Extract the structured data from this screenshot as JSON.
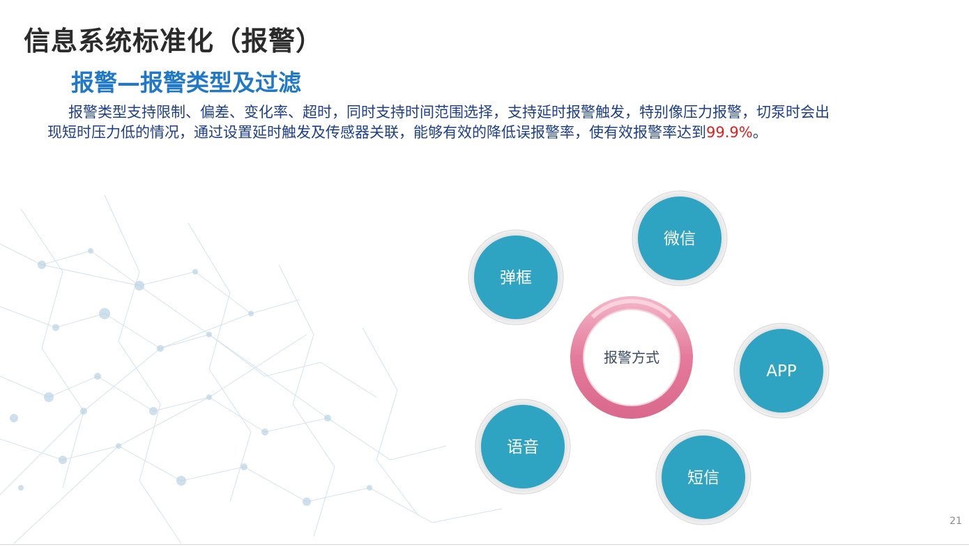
{
  "page": {
    "title": "信息系统标准化（报警）",
    "page_number": "21"
  },
  "section": {
    "heading": "报警—报警类型及过滤"
  },
  "description": {
    "text_before": "报警类型支持限制、偏差、变化率、超时，同时支持时间范围选择，支持延时报警触发，特别像压力报警，切泵时会出现短时压力低的情况，通过设置延时触发及传感器关联，能够有效的降低误报警率，使有效报警率达到",
    "highlight": "99.9%",
    "text_after": "。"
  },
  "diagram": {
    "center_label": "报警方式",
    "methods": [
      {
        "label": "弹框"
      },
      {
        "label": "微信"
      },
      {
        "label": "APP"
      },
      {
        "label": "短信"
      },
      {
        "label": "语音"
      }
    ]
  },
  "colors": {
    "node_fill": "#2ea3c2",
    "ring_pink": "#e47a9c",
    "title_text": "#2b2b2b",
    "section_text": "#1f78c8",
    "body_text": "#1d3f8a",
    "highlight": "#e0201c"
  }
}
